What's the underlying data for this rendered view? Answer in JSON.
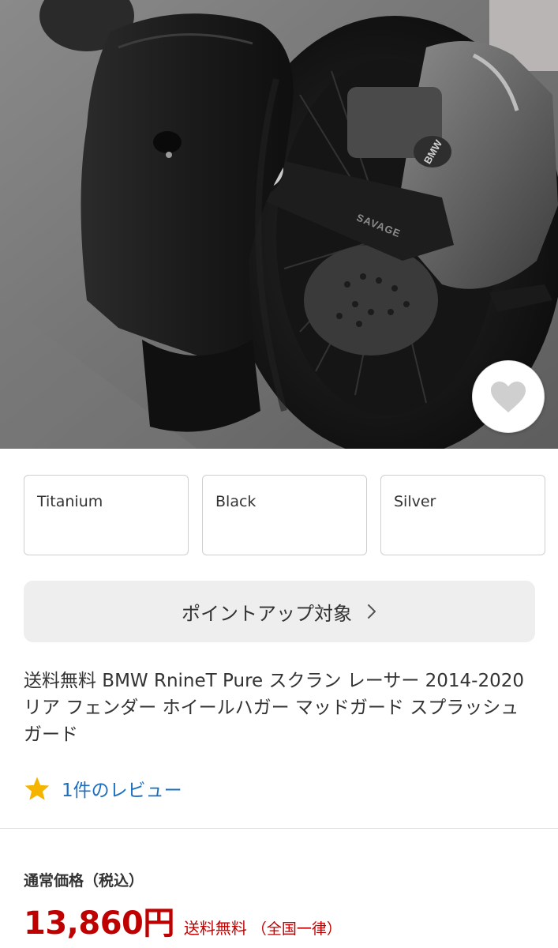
{
  "product_image": {
    "icon": "motorcycle-rear-fender-photo",
    "brand_marks": [
      "BMW",
      "SAVAGE"
    ]
  },
  "favorite": {
    "icon": "heart-icon"
  },
  "variants": [
    {
      "label": "Titanium"
    },
    {
      "label": "Black"
    },
    {
      "label": "Silver"
    }
  ],
  "point_up": {
    "label": "ポイントアップ対象",
    "icon": "chevron-right-icon"
  },
  "product": {
    "title": "送料無料 BMW RnineT Pure スクラン レーサー 2014-2020 リア フェンダー ホイールハガー マッドガード スプラッシュガード"
  },
  "reviews": {
    "icon": "star-icon",
    "label": "1件のレビュー"
  },
  "price": {
    "label": "通常価格（税込）",
    "value": "13,860円",
    "shipping": "送料無料",
    "shipping_note": "（全国一律）"
  },
  "colors": {
    "price_red": "#bf0000",
    "link_blue": "#1a6fc0",
    "star_yellow": "#f4b400",
    "heart_gray": "#cfcfcf"
  }
}
